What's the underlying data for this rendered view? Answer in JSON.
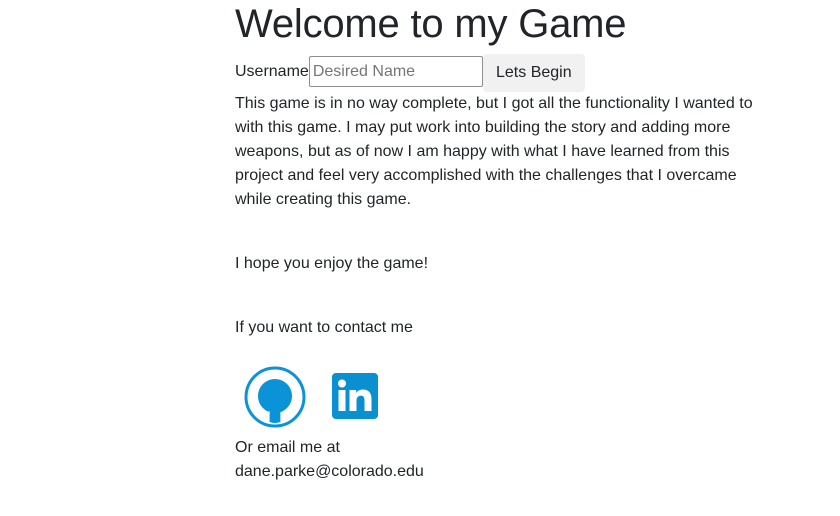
{
  "header": {
    "title": "Welcome to my Game"
  },
  "login": {
    "label": "Username",
    "input_placeholder": "Desired Name",
    "input_value": "",
    "button_label": "Lets Begin"
  },
  "content": {
    "intro": "This game is in no way complete, but I got all the functionality I wanted to with this game. I may put work into building the story and adding more weapons, but as of now I am happy with what I have learned from this project and feel very accomplished with the challenges that I overcame while creating this game.",
    "enjoy": "I hope you enjoy the game!",
    "contact": "If you want to contact me"
  },
  "social": {
    "github_icon": "github-icon",
    "linkedin_icon": "linkedin-icon",
    "github_color": "#0a93d6",
    "linkedin_color": "#0a8fd0"
  },
  "email": {
    "prefix": "Or email me at",
    "address": "dane.parke@colorado.edu"
  }
}
